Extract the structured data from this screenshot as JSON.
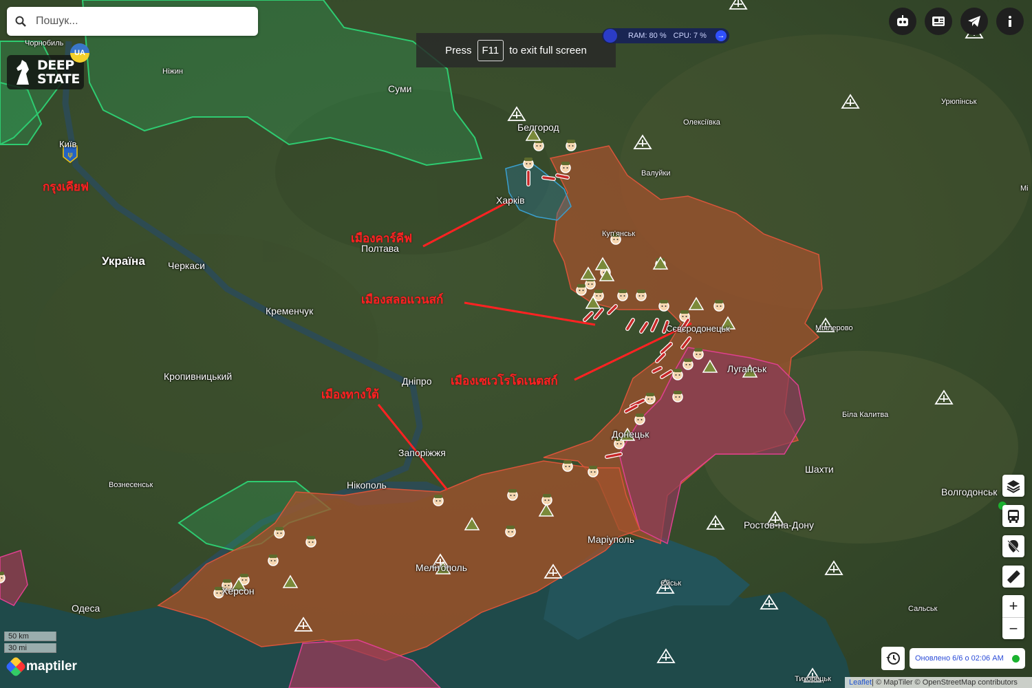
{
  "search": {
    "placeholder": "Пошук..."
  },
  "logo": {
    "line1": "DEEP",
    "line2": "STATE",
    "badge": "UA"
  },
  "fullscreen_notice": {
    "prefix": "Press",
    "key": "F11",
    "suffix": "to exit full screen"
  },
  "system_monitor": {
    "ram": "RAM: 80 %",
    "cpu": "CPU: 7 %"
  },
  "top_buttons": [
    "robot-icon",
    "newspaper-icon",
    "telegram-icon",
    "info-icon"
  ],
  "side_controls": [
    "layers-icon",
    "bus-icon",
    "pin-off-icon",
    "ruler-icon"
  ],
  "zoom": {
    "in": "+",
    "out": "−"
  },
  "updated": {
    "text": "Оновлено 6/6 о 02:06 AM",
    "status_color": "#1bb32f"
  },
  "attribution": {
    "leaflet": "Leaflet",
    "rest": " | © MapTiler © OpenStreetMap contributors"
  },
  "scale": {
    "km": "50 km",
    "mi": "30 mi"
  },
  "maptiler": "maptiler",
  "cities": [
    {
      "id": "chornobyl",
      "name": "Чорнобиль"
    },
    {
      "id": "nizhyn",
      "name": "Ніжин"
    },
    {
      "id": "kyiv",
      "name": "Київ"
    },
    {
      "id": "sumy",
      "name": "Суми"
    },
    {
      "id": "belgorod",
      "name": "Белгород"
    },
    {
      "id": "kharkiv",
      "name": "Харків"
    },
    {
      "id": "poltava",
      "name": "Полтава"
    },
    {
      "id": "ukraine",
      "name": "Україна"
    },
    {
      "id": "cherkasy",
      "name": "Черкаси"
    },
    {
      "id": "kremenchuk",
      "name": "Кременчук"
    },
    {
      "id": "kropyvnytskyi",
      "name": "Кропивницький"
    },
    {
      "id": "dnipro",
      "name": "Дніпро"
    },
    {
      "id": "zaporizhzhia",
      "name": "Запоріжжя"
    },
    {
      "id": "nikopol",
      "name": "Нікополь"
    },
    {
      "id": "voznesensk",
      "name": "Вознесенськ"
    },
    {
      "id": "odesa",
      "name": "Одеса"
    },
    {
      "id": "kherson",
      "name": "Херсон"
    },
    {
      "id": "melitopol",
      "name": "Мелітополь"
    },
    {
      "id": "mariupol",
      "name": "Маріуполь"
    },
    {
      "id": "donetsk",
      "name": "Донецьк"
    },
    {
      "id": "luhansk",
      "name": "Луганськ"
    },
    {
      "id": "kupiansk",
      "name": "Куп'янськ"
    },
    {
      "id": "sievierodonetsk",
      "name": "Сєвєродонецьк"
    },
    {
      "id": "shakhty",
      "name": "Шахти"
    },
    {
      "id": "rostov",
      "name": "Ростов-на-Дону"
    },
    {
      "id": "volgodonsk",
      "name": "Волгодонськ"
    },
    {
      "id": "bila-kalytva",
      "name": "Біла Калитва"
    },
    {
      "id": "millerovo",
      "name": "Міллерово"
    },
    {
      "id": "oleksiivka",
      "name": "Олексіївка"
    },
    {
      "id": "valuiky",
      "name": "Валуйки"
    },
    {
      "id": "uriupinsk",
      "name": "Урюпінськ"
    },
    {
      "id": "salsk",
      "name": "Сальськ"
    },
    {
      "id": "tykhoretsk",
      "name": "Тихорецьк"
    },
    {
      "id": "yeysk",
      "name": "Єйськ"
    },
    {
      "id": "mi",
      "name": "Мі"
    }
  ],
  "annotations": [
    {
      "id": "kyiv",
      "text": "กรุงเคียฟ"
    },
    {
      "id": "kharkiv",
      "text": "เมืองคาร์คีฟ"
    },
    {
      "id": "sloviansk",
      "text": "เมืองสลอแวนสก์"
    },
    {
      "id": "sievierodonetsk",
      "text": "เมืองเซเวโรโดเนตสก์"
    },
    {
      "id": "south",
      "text": "เมืองทางใต้"
    }
  ],
  "colors": {
    "occupied": "#a0522d",
    "occupied_old": "#9b3b5a",
    "liberated": "#2ecc71",
    "annotation": "#ff2222"
  }
}
